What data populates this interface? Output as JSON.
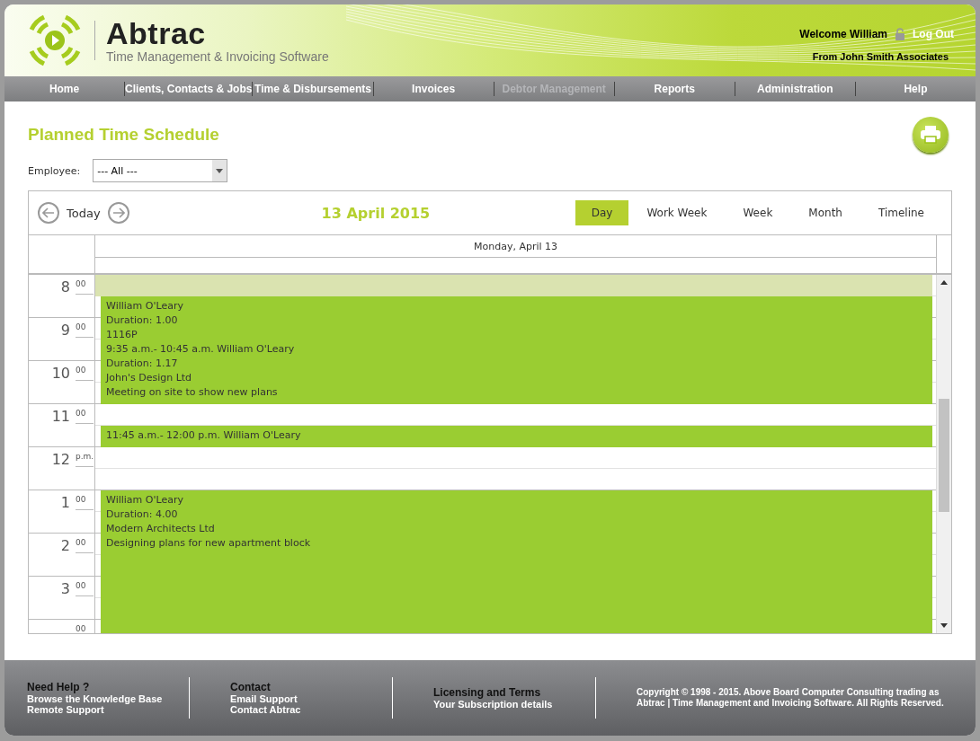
{
  "header": {
    "brand": "Abtrac",
    "tagline": "Time Management & Invoicing Software",
    "welcome": "Welcome William",
    "logout": "Log Out",
    "company": "From John Smith Associates"
  },
  "nav": [
    {
      "label": "Home",
      "disabled": false
    },
    {
      "label": "Clients, Contacts & Jobs",
      "disabled": false
    },
    {
      "label": "Time & Disbursements",
      "disabled": false
    },
    {
      "label": "Invoices",
      "disabled": false
    },
    {
      "label": "Debtor Management",
      "disabled": true
    },
    {
      "label": "Reports",
      "disabled": false
    },
    {
      "label": "Administration",
      "disabled": false
    },
    {
      "label": "Help",
      "disabled": false
    }
  ],
  "page_title": "Planned Time Schedule",
  "employee_filter": {
    "label": "Employee:",
    "value": "--- All ---"
  },
  "scheduler": {
    "today": "Today",
    "date": "13 April 2015",
    "views": [
      {
        "label": "Day",
        "selected": true
      },
      {
        "label": "Work Week",
        "selected": false
      },
      {
        "label": "Week",
        "selected": false
      },
      {
        "label": "Month",
        "selected": false
      },
      {
        "label": "Timeline",
        "selected": false
      }
    ],
    "day_header": "Monday, April 13",
    "hours": [
      {
        "hour": "8",
        "suffix": "00"
      },
      {
        "hour": "9",
        "suffix": "00"
      },
      {
        "hour": "10",
        "suffix": "00"
      },
      {
        "hour": "11",
        "suffix": "00"
      },
      {
        "hour": "12",
        "suffix": "p.m."
      },
      {
        "hour": "1",
        "suffix": "00"
      },
      {
        "hour": "2",
        "suffix": "00"
      },
      {
        "hour": "3",
        "suffix": "00"
      },
      {
        "suffix": "00"
      }
    ],
    "slots": [
      {
        "kind": "highlight"
      },
      {
        "kind": "event",
        "lines": [
          "William O'Leary",
          "Duration: 1.00",
          "1116P",
          "9:35 a.m.- 10:45 a.m. William O'Leary",
          "Duration: 1.17",
          "John's Design Ltd",
          "Meeting on site to show new plans"
        ]
      },
      {
        "kind": "continued"
      },
      {
        "kind": "continued"
      },
      {
        "kind": "continued"
      },
      {
        "kind": "continued"
      },
      {
        "kind": "free"
      },
      {
        "kind": "event",
        "lines": [
          "11:45 a.m.- 12:00 p.m. William O'Leary"
        ]
      },
      {
        "kind": "free"
      },
      {
        "kind": "free"
      },
      {
        "kind": "event",
        "lines": [
          "William O'Leary",
          "Duration: 4.00",
          "Modern Architects Ltd",
          "Designing plans for new apartment block"
        ]
      },
      {
        "kind": "continued"
      },
      {
        "kind": "continued"
      },
      {
        "kind": "continued"
      },
      {
        "kind": "continued"
      },
      {
        "kind": "continued"
      },
      {
        "kind": "continued"
      },
      {
        "kind": "continued"
      }
    ]
  },
  "footer": {
    "columns": [
      {
        "heading": "Need Help ?",
        "links": [
          "Browse the Knowledge Base",
          "Remote Support"
        ]
      },
      {
        "heading": "Contact",
        "links": [
          "Email Support",
          "Contact Abtrac"
        ]
      },
      {
        "heading": "Licensing and Terms",
        "links": [
          "Your Subscription details"
        ]
      }
    ],
    "copyright": "Copyright © 1998 - 2015. Above Board Computer Consulting trading as Abtrac | Time Management and Invoicing Software. All Rights Reserved."
  }
}
